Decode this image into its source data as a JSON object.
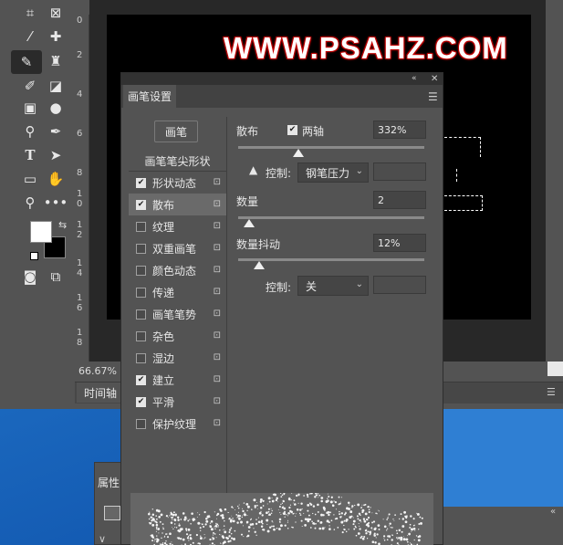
{
  "watermark": "WWW.PSAHZ.COM",
  "zoom": "66.67%",
  "timeline_tab": "时间轴",
  "properties_tab": "属性",
  "ruler_marks": [
    "0",
    "2",
    "4",
    "6",
    "8",
    "1",
    "0",
    "1",
    "2",
    "1",
    "4",
    "1",
    "6",
    "1",
    "8"
  ],
  "panel": {
    "tab": "画笔设置",
    "presets_button": "画笔",
    "list_header": "画笔笔尖形状",
    "items": [
      {
        "label": "形状动态",
        "checked": true
      },
      {
        "label": "散布",
        "checked": true
      },
      {
        "label": "纹理",
        "checked": false
      },
      {
        "label": "双重画笔",
        "checked": false
      },
      {
        "label": "颜色动态",
        "checked": false
      },
      {
        "label": "传递",
        "checked": false
      },
      {
        "label": "画笔笔势",
        "checked": false
      },
      {
        "label": "杂色",
        "checked": false
      },
      {
        "label": "湿边",
        "checked": false
      },
      {
        "label": "建立",
        "checked": true
      },
      {
        "label": "平滑",
        "checked": true
      },
      {
        "label": "保护纹理",
        "checked": false
      }
    ],
    "scatter_label": "散布",
    "both_axes_label": "两轴",
    "scatter_value": "332%",
    "control_label": "控制:",
    "control_scatter_value": "钢笔压力",
    "count_label": "数量",
    "count_value": "2",
    "count_jitter_label": "数量抖动",
    "count_jitter_value": "12%",
    "control_jitter_value": "关"
  }
}
